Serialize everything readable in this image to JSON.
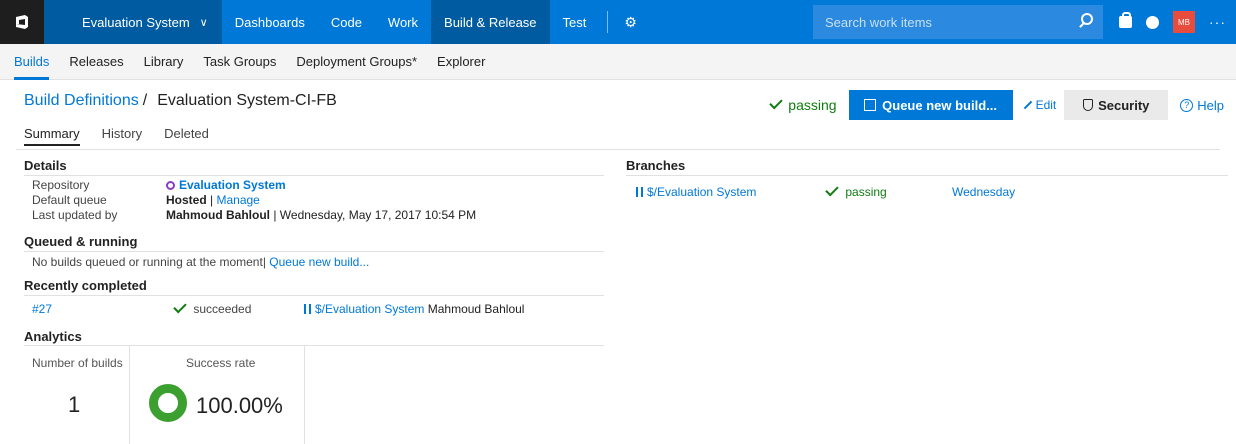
{
  "topbar": {
    "project": "Evaluation System",
    "hubs": [
      "Dashboards",
      "Code",
      "Work",
      "Build & Release",
      "Test"
    ],
    "active_hub": "Build & Release",
    "search_placeholder": "Search work items",
    "avatar_initials": "MB",
    "more": "···"
  },
  "subnav": {
    "items": [
      "Builds",
      "Releases",
      "Library",
      "Task Groups",
      "Deployment Groups*",
      "Explorer"
    ],
    "active": "Builds"
  },
  "header": {
    "breadcrumb_link": "Build Definitions",
    "separator": "/",
    "title": "Evaluation System-CI-FB",
    "status": "passing",
    "queue_button": "Queue new build...",
    "edit_label": "Edit",
    "security_label": "Security",
    "help_label": "Help"
  },
  "tabs": [
    "Summary",
    "History",
    "Deleted"
  ],
  "details": {
    "title": "Details",
    "repository_label": "Repository",
    "repository_value": "Evaluation System",
    "queue_label": "Default queue",
    "queue_value": "Hosted",
    "queue_sep": "|",
    "queue_manage": "Manage",
    "updated_label": "Last updated by",
    "updated_by": "Mahmoud Bahloul",
    "updated_when": "| Wednesday, May 17, 2017 10:54 PM"
  },
  "queued": {
    "title": "Queued & running",
    "message": "No builds queued or running at the moment|",
    "link": "Queue new build..."
  },
  "recent": {
    "title": "Recently completed",
    "rows": [
      {
        "id": "#27",
        "status": "succeeded",
        "branch": "$/Evaluation System",
        "user": "Mahmoud Bahloul"
      }
    ]
  },
  "analytics": {
    "title": "Analytics",
    "builds_label": "Number of builds",
    "builds_value": "1",
    "rate_label": "Success rate",
    "rate_value": "100.00%",
    "success_rate": 1.0
  },
  "branches": {
    "title": "Branches",
    "rows": [
      {
        "name": "$/Evaluation System",
        "status": "passing",
        "when": "Wednesday"
      }
    ]
  },
  "colors": {
    "accent": "#0078d7",
    "topbar_dark": "#005ba1",
    "success": "#107c10",
    "donut": "#3ca031"
  }
}
